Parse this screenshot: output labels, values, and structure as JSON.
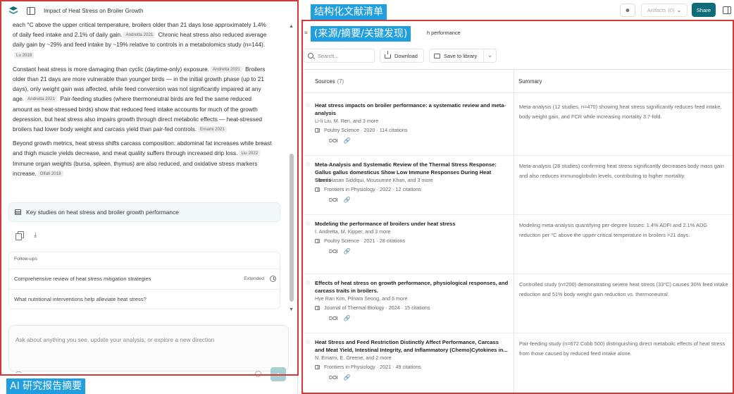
{
  "left_panel": {
    "title": "Impact of Heat Stress on Broiler Growth",
    "paragraphs": [
      {
        "segments": [
          {
            "text": "each °C above the upper critical temperature, broilers older than 21 days lose approximately 1.4% of daily feed intake and 2.1% of daily gain.",
            "cite": "Andretta 2021"
          },
          {
            "text": " Chronic heat stress also reduced average daily gain by ~29% and feed intake by ~19% relative to controls in a metabolomics study (n=144).",
            "cite": "Lu 2018"
          }
        ]
      },
      {
        "segments": [
          {
            "text": "Constant heat stress is more damaging than cyclic (daytime-only) exposure.",
            "cite": "Andretta 2021"
          },
          {
            "text": " Broilers older than 21 days are more vulnerable than younger birds — in the initial growth phase (up to 21 days), only weight gain was affected, while feed conversion was not significantly impaired at any age.",
            "cite": "Andretta 2021"
          },
          {
            "text": " Pair-feeding studies (where thermoneutral birds are fed the same reduced amount as heat-stressed birds) show that reduced feed intake accounts for much of the growth depression, but heat stress also impairs growth through direct metabolic effects — heat-stressed broilers had lower body weight and carcass yield than pair-fed controls.",
            "cite": "Emami 2021"
          }
        ]
      },
      {
        "segments": [
          {
            "text": "Beyond growth metrics, heat stress shifts carcass composition: abdominal fat increases while breast and thigh muscle yields decrease, and meat quality suffers through increased drip loss.",
            "cite": "Liu 2022"
          },
          {
            "text": " Immune organ weights (bursa, spleen, thymus) are also reduced, and oxidative stress markers increase.",
            "cite": "Olfati 2018"
          }
        ]
      }
    ],
    "key_studies_label": "Key studies on heat stress and broiler growth performance",
    "followups": {
      "title": "Follow-ups",
      "items": [
        {
          "text": "Comprehensive review of heat stress mitigation strategies",
          "badge": "Extended"
        },
        {
          "text": "What nutritional interventions help alleviate heat stress?",
          "badge": ""
        }
      ]
    },
    "chat": {
      "placeholder": "Ask about anything you see, update your analysis, or explore a new direction"
    }
  },
  "annotations": {
    "left": "AI 研究报告摘要",
    "right_line1": "结构化文献清单",
    "right_line2": "(来源/摘要/关键发现)"
  },
  "topbar": {
    "artifacts_label": "Artifacts",
    "artifacts_count": "(0)",
    "share_label": "Share"
  },
  "right_panel": {
    "tab_label": "h performance",
    "search_placeholder": "Search...",
    "download_label": "Download",
    "save_label": "Save to library",
    "sources_header": "Sources",
    "sources_count": "(7)",
    "summary_header": "Summary",
    "doi_label": "DOI",
    "rows": [
      {
        "title": "Heat stress impacts on broiler performance: a systematic review and meta-analysis",
        "authors": "Li-li Liu, M. Ren, and 3 more",
        "journal": "Poultry Science · 2020 · 114 citations",
        "summary": "Meta-analysis (12 studies, n=470) showing heat stress significantly reduces feed intake, body weight gain, and FCR while increasing mortality 3.7-fold."
      },
      {
        "title": "Meta-Analysis and Systematic Review of the Thermal Stress Response: Gallus gallus domesticus Show Low Immune Responses During Heat Stress",
        "authors": "Sharif Hasan Siddiqui, Mousumee Khan, and 3 more",
        "journal": "Frontiers in Physiology · 2022 · 12 citations",
        "summary": "Meta-analysis (28 studies) confirming heat stress significantly decreases body mass gain and also reduces immunoglobulin levels, contributing to higher mortality."
      },
      {
        "title": "Modeling the performance of broilers under heat stress",
        "authors": "I. Andretta, M. Kipper, and 3 more",
        "journal": "Poultry Science · 2021 · 28 citations",
        "summary": "Modeling meta-analysis quantifying per-degree losses: 1.4% ADFI and 2.1% ADG reduction per °C above the upper critical temperature in broilers >21 days."
      },
      {
        "title": "Effects of heat stress on growth performance, physiological responses, and carcass traits in broilers.",
        "authors": "Hye Ran Kim, Pilnam Seong, and 6 more",
        "journal": "Journal of Thermal Biology · 2024 · 15 citations",
        "summary": "Controlled study (n=200) demonstrating severe heat stress (33°C) causes 30% feed intake reduction and 51% body weight gain reduction vs. thermoneutral."
      },
      {
        "title": "Heat Stress and Feed Restriction Distinctly Affect Performance, Carcass and Meat Yield, Intestinal Integrity, and Inflammatory (Chemo)Cytokines in...",
        "authors": "N. Emami, E. Greene, and 2 more",
        "journal": "Frontiers in Physiology · 2021 · 49 citations",
        "summary": "Pair-feeding study (n=672 Cobb 500) distinguishing direct metabolic effects of heat stress from those caused by reduced feed intake alone."
      }
    ]
  },
  "colors": {
    "accent": "#0f6d79",
    "annotation_frame": "#d23a3a",
    "annotation_label": "#1f9ee0"
  }
}
